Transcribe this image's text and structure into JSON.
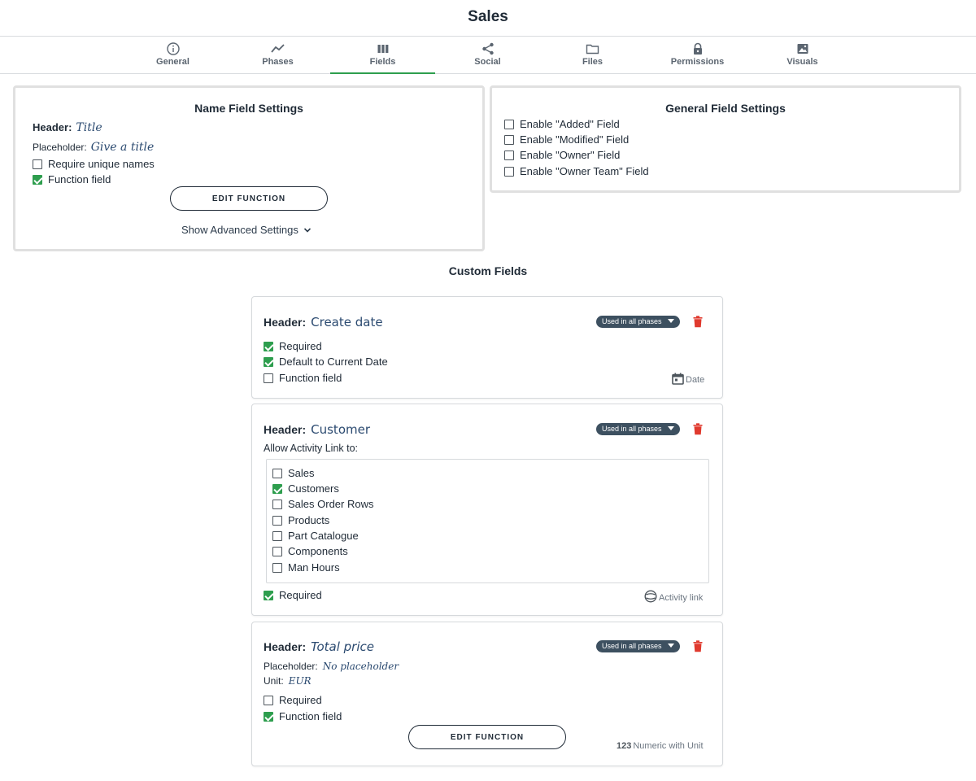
{
  "page_title": "Sales",
  "tabs": [
    {
      "label": "General",
      "icon": "info-icon"
    },
    {
      "label": "Phases",
      "icon": "chart-line-icon"
    },
    {
      "label": "Fields",
      "icon": "columns-icon",
      "active": true
    },
    {
      "label": "Social",
      "icon": "share-icon"
    },
    {
      "label": "Files",
      "icon": "folder-icon"
    },
    {
      "label": "Permissions",
      "icon": "lock-icon"
    },
    {
      "label": "Visuals",
      "icon": "image-icon"
    }
  ],
  "name_field_settings": {
    "title": "Name Field Settings",
    "header_label": "Header:",
    "header_value": "Title",
    "placeholder_label": "Placeholder:",
    "placeholder_value": "Give a title",
    "require_unique_label": "Require unique names",
    "require_unique_checked": false,
    "function_field_label": "Function field",
    "function_field_checked": true,
    "edit_function_label": "EDIT FUNCTION",
    "advanced_label": "Show Advanced Settings"
  },
  "general_field_settings": {
    "title": "General Field Settings",
    "options": [
      {
        "label": "Enable \"Added\" Field",
        "checked": false
      },
      {
        "label": "Enable \"Modified\" Field",
        "checked": false
      },
      {
        "label": "Enable \"Owner\" Field",
        "checked": false
      },
      {
        "label": "Enable \"Owner Team\" Field",
        "checked": false
      }
    ]
  },
  "custom_fields": {
    "title": "Custom Fields",
    "phase_pill_label": "Used in all phases",
    "cards": [
      {
        "header_label": "Header:",
        "header_value": "Create date",
        "options": [
          {
            "label": "Required",
            "checked": true
          },
          {
            "label": "Default to Current Date",
            "checked": true
          },
          {
            "label": "Function field",
            "checked": false
          }
        ],
        "type_label": "Date",
        "type_icon": "calendar-icon"
      },
      {
        "header_label": "Header:",
        "header_value": "Customer",
        "allow_link_label": "Allow Activity Link to:",
        "link_targets": [
          {
            "label": "Sales",
            "checked": false
          },
          {
            "label": "Customers",
            "checked": true
          },
          {
            "label": "Sales Order Rows",
            "checked": false
          },
          {
            "label": "Products",
            "checked": false
          },
          {
            "label": "Part Catalogue",
            "checked": false
          },
          {
            "label": "Components",
            "checked": false
          },
          {
            "label": "Man Hours",
            "checked": false
          }
        ],
        "required_label": "Required",
        "required_checked": true,
        "type_label": "Activity link",
        "type_icon": "activity-link-icon"
      },
      {
        "header_label": "Header:",
        "header_value": "Total price",
        "placeholder_label": "Placeholder:",
        "placeholder_value": "No placeholder",
        "unit_label": "Unit:",
        "unit_value": "EUR",
        "options": [
          {
            "label": "Required",
            "checked": false
          },
          {
            "label": "Function field",
            "checked": true
          }
        ],
        "edit_function_label": "EDIT FUNCTION",
        "type_prefix": "123",
        "type_label": "Numeric with Unit"
      }
    ]
  },
  "colors": {
    "accent_green": "#2e9e4e",
    "pill_bg": "#3d5060",
    "danger_red": "#e03a2e"
  }
}
